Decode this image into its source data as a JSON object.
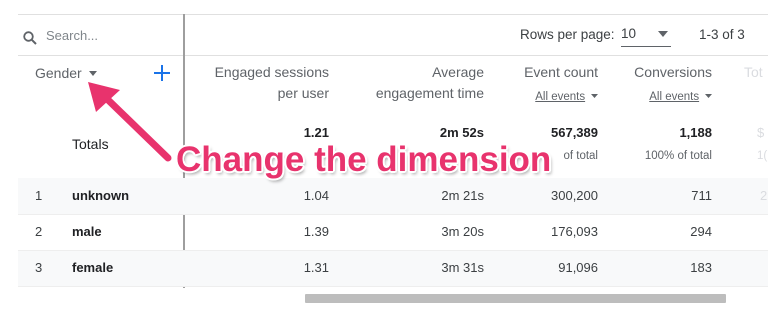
{
  "search": {
    "placeholder": "Search..."
  },
  "pagination": {
    "rows_label": "Rows per page:",
    "rows_value": "10",
    "range": "1-3 of 3"
  },
  "dimension": {
    "label": "Gender"
  },
  "columns": [
    {
      "line1": "Engaged sessions",
      "line2": "per user"
    },
    {
      "line1": "Average",
      "line2": "engagement time"
    },
    {
      "line1": "Event count",
      "sub": "All events"
    },
    {
      "line1": "Conversions",
      "sub": "All events"
    },
    {
      "line1": "Tot"
    }
  ],
  "totals": {
    "label": "Totals",
    "engaged": "1.21",
    "avg_time": "2m 52s",
    "event_count": "567,389",
    "event_pct": "of total",
    "conversions": "1,188",
    "conv_pct": "100% of total",
    "extra_top": "$",
    "extra_bottom": "1("
  },
  "rows": [
    {
      "index": "1",
      "name": "unknown",
      "engaged": "1.04",
      "avg_time": "2m 21s",
      "event_count": "300,200",
      "conversions": "711",
      "extra": "2"
    },
    {
      "index": "2",
      "name": "male",
      "engaged": "1.39",
      "avg_time": "3m 20s",
      "event_count": "176,093",
      "conversions": "294",
      "extra": ""
    },
    {
      "index": "3",
      "name": "female",
      "engaged": "1.31",
      "avg_time": "3m 31s",
      "event_count": "91,096",
      "conversions": "183",
      "extra": ""
    }
  ],
  "annotation": {
    "text": "Change the dimension"
  },
  "colors": {
    "accent": "#1a73e8",
    "annotation": "#e8336d"
  }
}
